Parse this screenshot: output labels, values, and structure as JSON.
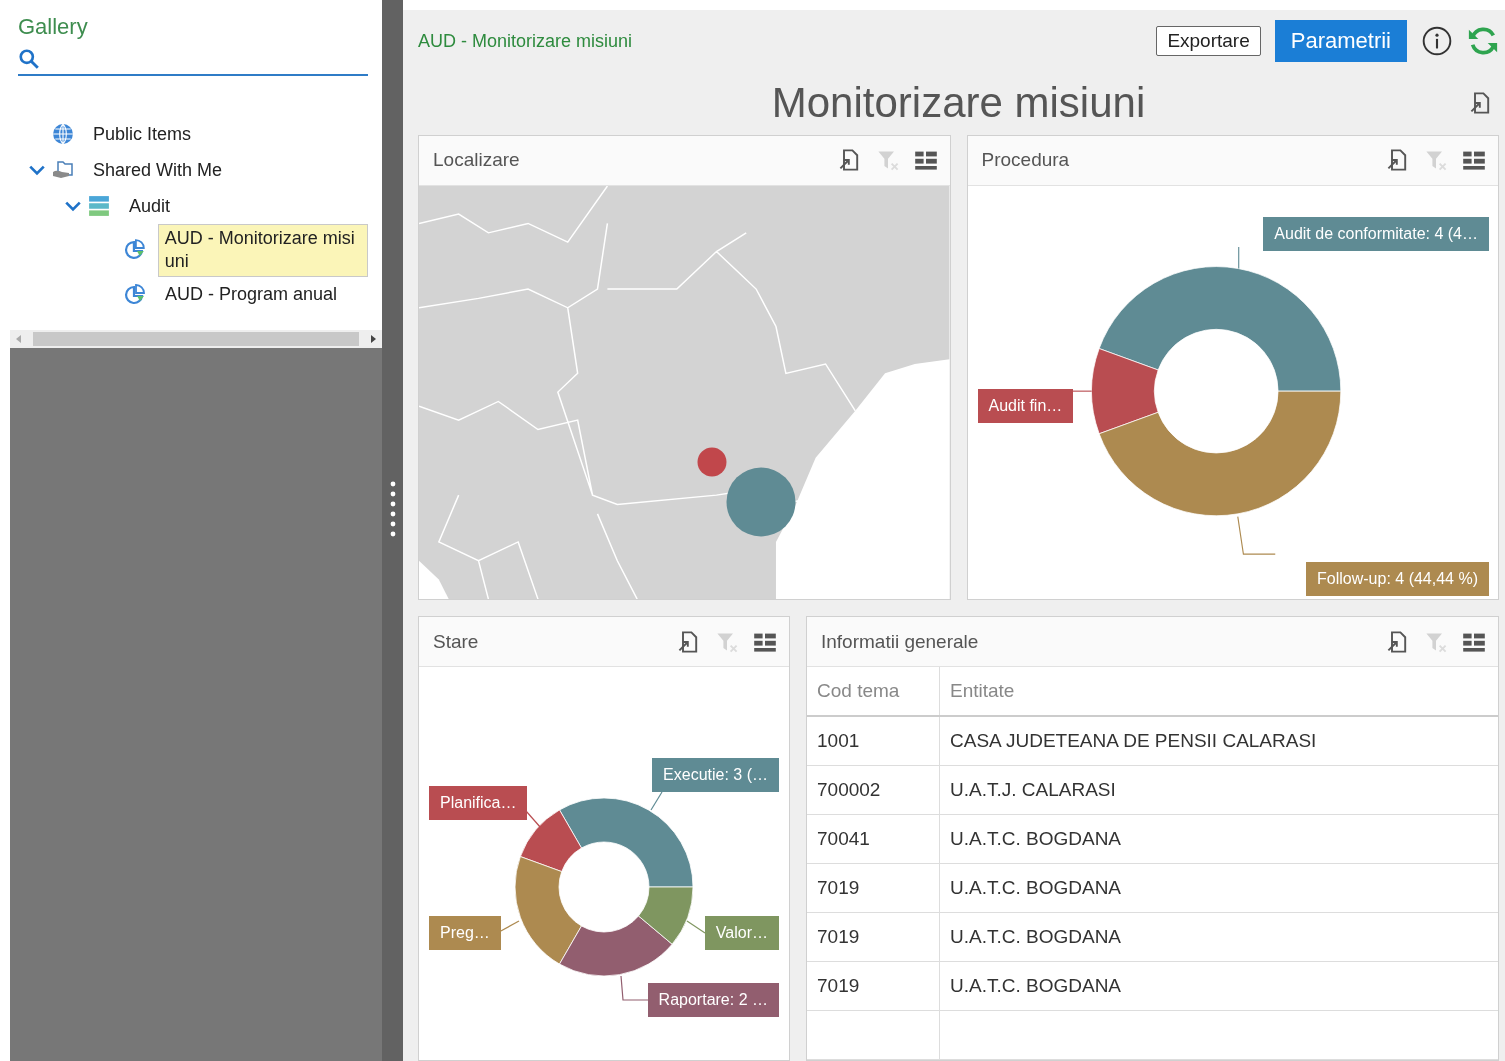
{
  "gallery": {
    "title": "Gallery",
    "tree": [
      {
        "label": "Public Items",
        "kind": "globe",
        "selected": false
      },
      {
        "label": "Shared With Me",
        "kind": "shared",
        "selected": false,
        "expanded": true,
        "children": [
          {
            "label": "Audit",
            "kind": "folder",
            "selected": false,
            "expanded": true,
            "children": [
              {
                "label": "AUD - Monitorizare misiuni",
                "kind": "dashboard",
                "selected": true
              },
              {
                "label": "AUD - Program anual",
                "kind": "dashboard",
                "selected": false
              }
            ]
          }
        ]
      }
    ]
  },
  "header": {
    "breadcrumb": "AUD - Monitorizare misiuni",
    "buttons": [
      {
        "label": "Exportare",
        "kind": "outline"
      },
      {
        "label": "Parametrii",
        "kind": "primary"
      }
    ]
  },
  "title": "Monitorizare misiuni",
  "panels": [
    {
      "title": "Localizare",
      "kind": "map"
    },
    {
      "title": "Procedura",
      "kind": "donut",
      "chart_data": {
        "type": "donut",
        "values": [
          4,
          1,
          4
        ],
        "colors": [
          "#5f8b94",
          "#b94d51",
          "#ad8a50"
        ],
        "value_labels": [
          "Audit de conformitate: 4 (4…",
          "Audit fin…",
          "Follow-up: 4 (44,44 %)"
        ]
      }
    },
    {
      "title": "Stare",
      "kind": "donut",
      "chart_data": {
        "type": "donut",
        "values": [
          3,
          1,
          2,
          2,
          1
        ],
        "colors": [
          "#5f8b94",
          "#b94d51",
          "#ad8a50",
          "#925e6f",
          "#7f9660"
        ],
        "value_labels": [
          "Executie: 3 (…",
          "Planifica…",
          "Preg…",
          "Raportare: 2 …",
          "Valor…"
        ]
      }
    },
    {
      "title": "Informatii generale",
      "kind": "table",
      "columns": [
        "Cod tema",
        "Entitate"
      ],
      "rows": [
        [
          "1001",
          "CASA JUDETEANA DE PENSII CALARASI"
        ],
        [
          "700002",
          "U.A.T.J. CALARASI"
        ],
        [
          "70041",
          "U.A.T.C. BOGDANA"
        ],
        [
          "7019",
          "U.A.T.C. BOGDANA"
        ],
        [
          "7019",
          "U.A.T.C. BOGDANA"
        ],
        [
          "7019",
          "U.A.T.C. BOGDANA"
        ]
      ]
    }
  ]
}
